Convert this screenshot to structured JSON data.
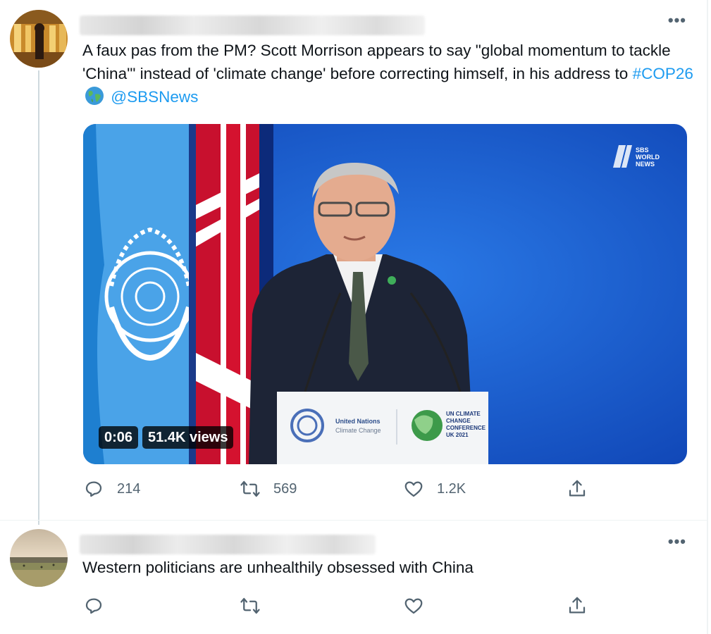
{
  "tweet1": {
    "text_before": "A faux pas from the PM? Scott Morrison appears to say \"global momentum to tackle 'China'\" instead of 'climate change' before correcting himself, in his address to ",
    "hashtag": "#COP26",
    "mention": "@SBSNews",
    "media": {
      "duration": "0:06",
      "views": "51.4K views",
      "watermark": [
        "SBS",
        "WORLD",
        "NEWS"
      ],
      "podium_text": [
        "United Nations",
        "Climate Change"
      ],
      "podium_badge": [
        "UN CLIMATE",
        "CHANGE",
        "CONFERENCE",
        "UK 2021"
      ]
    },
    "stats": {
      "replies": "214",
      "retweets": "569",
      "likes": "1.2K"
    }
  },
  "tweet2": {
    "text": "Western politicians are unhealthily obsessed with China",
    "stats": {
      "replies": "",
      "retweets": "",
      "likes": ""
    }
  },
  "more_label": "•••",
  "icons": [
    "reply-icon",
    "retweet-icon",
    "like-icon",
    "share-icon",
    "more-icon",
    "globe-emoji-icon"
  ],
  "colors": {
    "link": "#1d9bf0",
    "muted": "#536471",
    "text": "#0f1419",
    "video_bg": "#1a5fd0"
  }
}
